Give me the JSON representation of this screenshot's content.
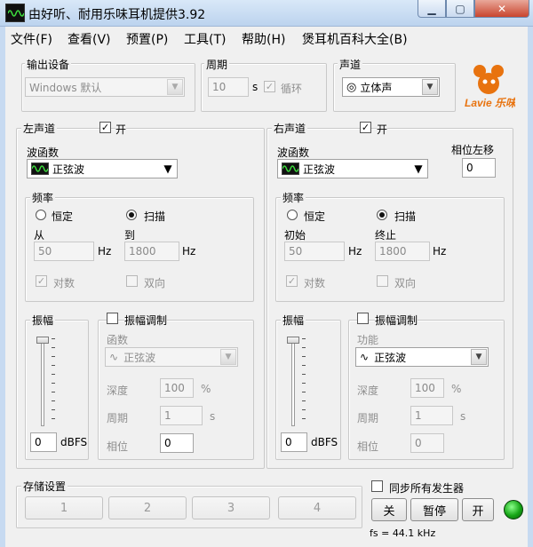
{
  "window": {
    "title": "由好听、耐用乐味耳机提供3.92",
    "min_icon": "minimize-icon",
    "max_icon": "maximize-icon",
    "close_icon": "close-icon"
  },
  "menu": [
    "文件(F)",
    "查看(V)",
    "预置(P)",
    "工具(T)",
    "帮助(H)",
    "煲耳机百科大全(B)"
  ],
  "output": {
    "label": "输出设备",
    "device": "Windows 默认"
  },
  "period": {
    "label": "周期",
    "value": "10",
    "unit": "s",
    "loop_label": "循环",
    "loop_checked": true
  },
  "channel_mode": {
    "label": "声道",
    "value": "立体声"
  },
  "logo": {
    "text": "Lavie 乐味"
  },
  "left": {
    "label": "左声道",
    "on_label": "开",
    "on_checked": true,
    "waveform_label": "波函数",
    "waveform": "正弦波",
    "freq": {
      "label": "频率",
      "const_label": "恒定",
      "sweep_label": "扫描",
      "mode": "sweep",
      "from_label": "从",
      "from": "50",
      "to_label": "到",
      "to": "1800",
      "unit": "Hz",
      "log_label": "对数",
      "log_checked": true,
      "bidir_label": "双向",
      "bidir_checked": false
    },
    "amp": {
      "label": "振幅",
      "value": "0",
      "unit": "dBFS"
    },
    "mod": {
      "label": "振幅调制",
      "checked": false,
      "func_label": "函数",
      "func": "正弦波",
      "depth_label": "深度",
      "depth": "100",
      "depth_unit": "%",
      "period_label": "周期",
      "period": "1",
      "period_unit": "s",
      "phase_label": "相位",
      "phase": "0"
    }
  },
  "right": {
    "label": "右声道",
    "on_label": "开",
    "on_checked": true,
    "waveform_label": "波函数",
    "waveform": "正弦波",
    "phase_shift_label": "相位左移",
    "phase_shift": "0",
    "freq": {
      "label": "频率",
      "const_label": "恒定",
      "sweep_label": "扫描",
      "mode": "sweep",
      "from_label": "初始",
      "from": "50",
      "to_label": "终止",
      "to": "1800",
      "unit": "Hz",
      "log_label": "对数",
      "log_checked": true,
      "bidir_label": "双向",
      "bidir_checked": false
    },
    "amp": {
      "label": "振幅",
      "value": "0",
      "unit": "dBFS"
    },
    "mod": {
      "label": "振幅调制",
      "checked": false,
      "func_label": "功能",
      "func": "正弦波",
      "depth_label": "深度",
      "depth": "100",
      "depth_unit": "%",
      "period_label": "周期",
      "period": "1",
      "period_unit": "s",
      "phase_label": "相位",
      "phase": "0"
    }
  },
  "presets": {
    "label": "存储设置",
    "slots": [
      "1",
      "2",
      "3",
      "4"
    ]
  },
  "sync": {
    "label": "同步所有发生器",
    "checked": false
  },
  "controls": {
    "off": "关",
    "pause": "暂停",
    "on": "开"
  },
  "status": {
    "fs": "fs = 44.1 kHz"
  },
  "colors": {
    "titlebar": "#c7daf1",
    "led": "#16a516",
    "logo": "#e8730f"
  }
}
